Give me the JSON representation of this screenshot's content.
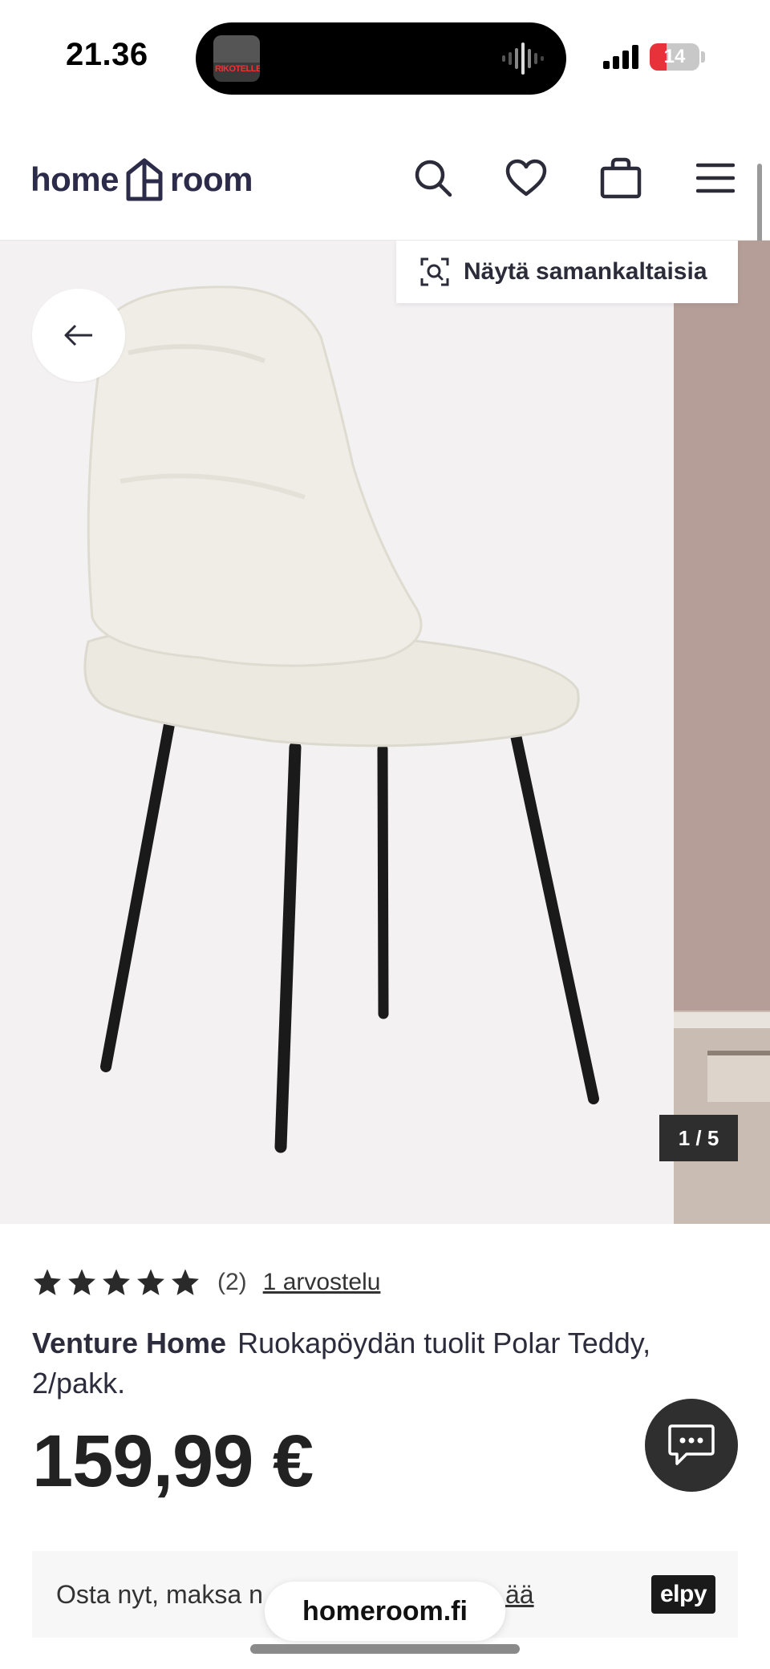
{
  "status_bar": {
    "time": "21.36",
    "album_art_text": "RIKOTELLEN",
    "battery_level": "14",
    "battery_fraction": 0.14,
    "battery_color": "#e8323a"
  },
  "header": {
    "logo_left": "home",
    "logo_right": "room",
    "icons": [
      "search-icon",
      "heart-icon",
      "bag-icon",
      "menu-icon"
    ],
    "brand_color": "#2c2c4a"
  },
  "gallery": {
    "similar_label": "Näytä samankaltaisia",
    "counter": "1 / 5",
    "current_slide": 1,
    "total_slides": 5
  },
  "product": {
    "rating_stars": 5,
    "review_count": "(2)",
    "reviews_link": "1 arvostelu",
    "brand": "Venture Home",
    "title": "Ruokapöydän tuolit Polar Teddy, 2/pakk.",
    "price": "159,99 €"
  },
  "finance": {
    "text": "Osta nyt, maksa n",
    "link": "ää",
    "provider": "elpy"
  },
  "browser": {
    "url": "homeroom.fi"
  }
}
